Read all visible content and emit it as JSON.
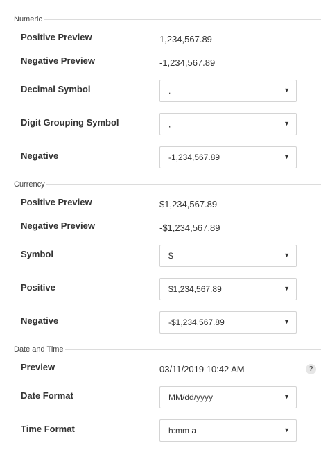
{
  "numeric": {
    "title": "Numeric",
    "positive_preview_label": "Positive Preview",
    "positive_preview_value": "1,234,567.89",
    "negative_preview_label": "Negative Preview",
    "negative_preview_value": "-1,234,567.89",
    "decimal_symbol_label": "Decimal Symbol",
    "decimal_symbol_value": ".",
    "digit_grouping_label": "Digit Grouping Symbol",
    "digit_grouping_value": ",",
    "negative_label": "Negative",
    "negative_value": "-1,234,567.89"
  },
  "currency": {
    "title": "Currency",
    "positive_preview_label": "Positive Preview",
    "positive_preview_value": "$1,234,567.89",
    "negative_preview_label": "Negative Preview",
    "negative_preview_value": "-$1,234,567.89",
    "symbol_label": "Symbol",
    "symbol_value": "$",
    "positive_label": "Positive",
    "positive_value": "$1,234,567.89",
    "negative_label": "Negative",
    "negative_value": "-$1,234,567.89"
  },
  "datetime": {
    "title": "Date and Time",
    "preview_label": "Preview",
    "preview_value": "03/11/2019 10:42 AM",
    "help_icon": "?",
    "date_format_label": "Date Format",
    "date_format_value": "MM/dd/yyyy",
    "time_format_label": "Time Format",
    "time_format_value": "h:mm a"
  },
  "caret_glyph": "▼"
}
